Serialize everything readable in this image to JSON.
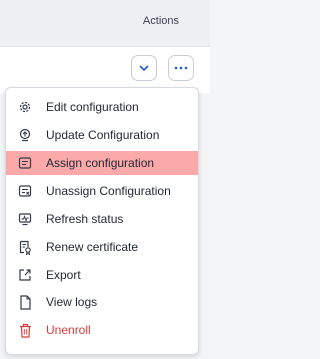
{
  "header": {
    "column_label": "Actions"
  },
  "toolbar": {
    "expand_icon": "chevron-down-icon",
    "more_icon": "more-horizontal-icon",
    "accent_color": "#1f5fc4"
  },
  "menu": {
    "items": [
      {
        "label": "Edit configuration",
        "icon": "gear-icon"
      },
      {
        "label": "Update Configuration",
        "icon": "update-configuration-icon"
      },
      {
        "label": "Assign configuration",
        "icon": "assign-configuration-icon",
        "highlighted": true,
        "highlight_color": "#fba9a9"
      },
      {
        "label": "Unassign Configuration",
        "icon": "unassign-configuration-icon"
      },
      {
        "label": "Refresh status",
        "icon": "refresh-status-icon"
      },
      {
        "label": "Renew certificate",
        "icon": "certificate-icon"
      },
      {
        "label": "Export",
        "icon": "export-icon"
      },
      {
        "label": "View logs",
        "icon": "document-icon"
      },
      {
        "label": "Unenroll",
        "icon": "trash-icon",
        "danger": true,
        "danger_color": "#d63c3c"
      }
    ]
  }
}
